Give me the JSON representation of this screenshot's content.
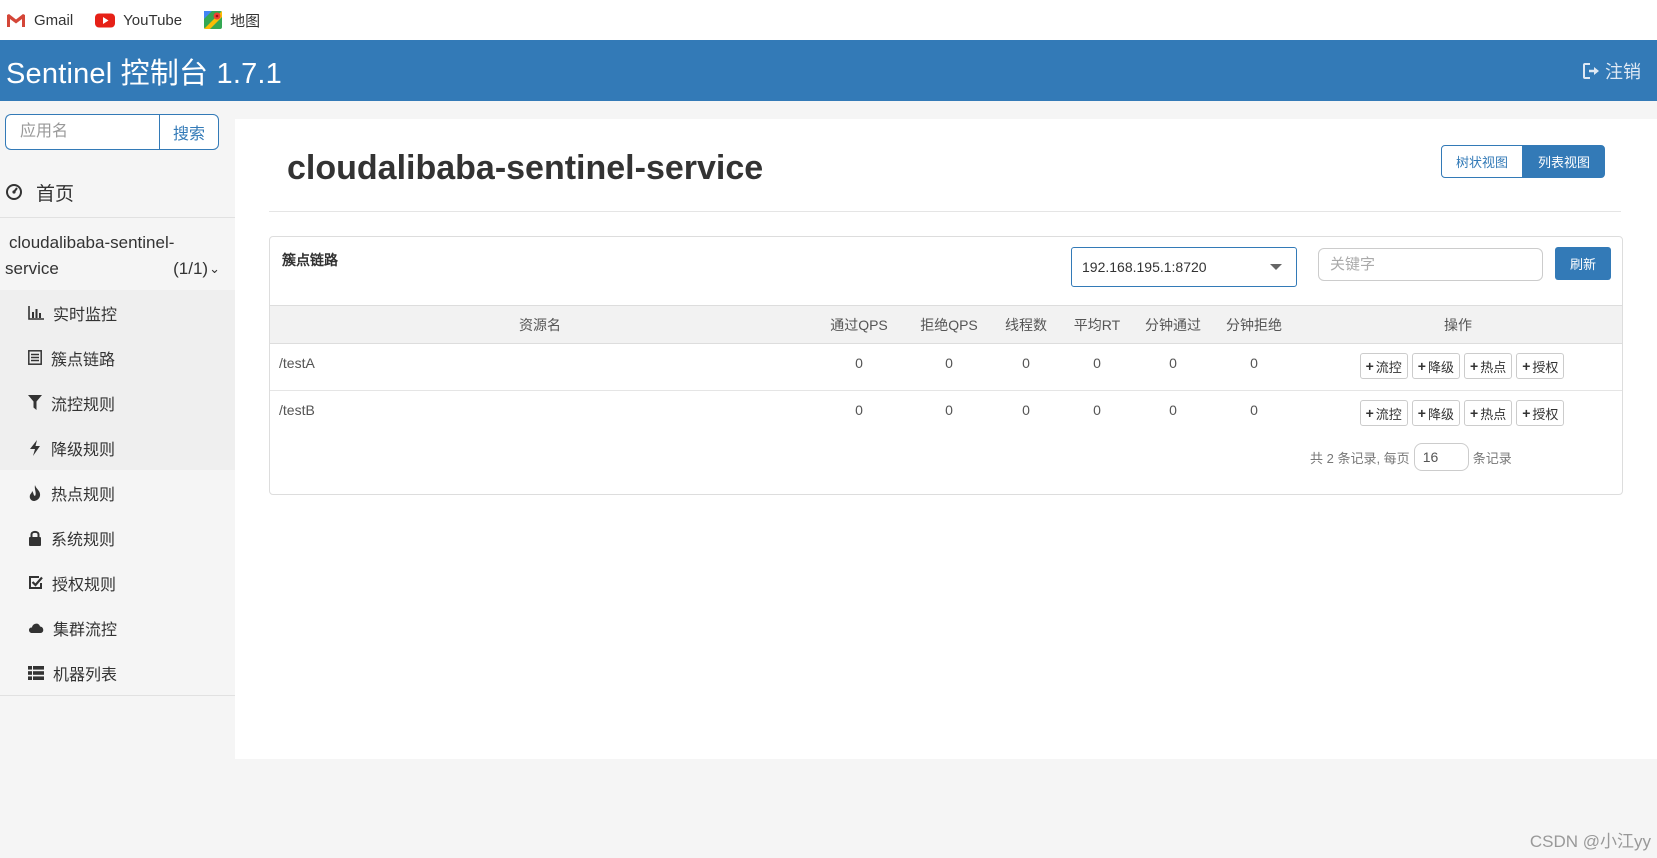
{
  "bookmarks": [
    {
      "label": "Gmail",
      "icon": "gmail-icon"
    },
    {
      "label": "YouTube",
      "icon": "youtube-icon"
    },
    {
      "label": "地图",
      "icon": "maps-icon"
    }
  ],
  "header": {
    "title": "Sentinel 控制台 1.7.1",
    "logout_label": "注销"
  },
  "sidebar": {
    "search_placeholder": "应用名",
    "search_button": "搜索",
    "home_label": "首页",
    "app": {
      "name_line1": "cloudalibaba-sentinel-",
      "name_line2": "service",
      "count": "(1/1)"
    },
    "menu": [
      {
        "label": "实时监控",
        "icon": "bar-chart-icon"
      },
      {
        "label": "簇点链路",
        "icon": "list-alt-icon"
      },
      {
        "label": "流控规则",
        "icon": "filter-icon"
      },
      {
        "label": "降级规则",
        "icon": "flash-icon"
      },
      {
        "label": "热点规则",
        "icon": "fire-icon"
      },
      {
        "label": "系统规则",
        "icon": "lock-icon"
      },
      {
        "label": "授权规则",
        "icon": "check-icon"
      },
      {
        "label": "集群流控",
        "icon": "cloud-icon"
      },
      {
        "label": "机器列表",
        "icon": "th-list-icon"
      }
    ]
  },
  "main": {
    "title": "cloudalibaba-sentinel-service",
    "tree_view": "树状视图",
    "list_view": "列表视图",
    "card_title": "簇点链路",
    "machine": "192.168.195.1:8720",
    "keyword_placeholder": "关键字",
    "refresh": "刷新",
    "columns": [
      "资源名",
      "通过QPS",
      "拒绝QPS",
      "线程数",
      "平均RT",
      "分钟通过",
      "分钟拒绝",
      "操作"
    ],
    "rows": [
      {
        "name": "/testA",
        "pass_qps": "0",
        "block_qps": "0",
        "threads": "0",
        "avg_rt": "0",
        "min_pass": "0",
        "min_block": "0"
      },
      {
        "name": "/testB",
        "pass_qps": "0",
        "block_qps": "0",
        "threads": "0",
        "avg_rt": "0",
        "min_pass": "0",
        "min_block": "0"
      }
    ],
    "ops": [
      "流控",
      "降级",
      "热点",
      "授权"
    ],
    "pager": {
      "prefix": "共 2 条记录, 每页",
      "page_size": "16",
      "suffix": "条记录"
    }
  },
  "watermark": "CSDN @小江yy",
  "colors": {
    "primary": "#337ab7",
    "background": "#f5f5f5"
  }
}
